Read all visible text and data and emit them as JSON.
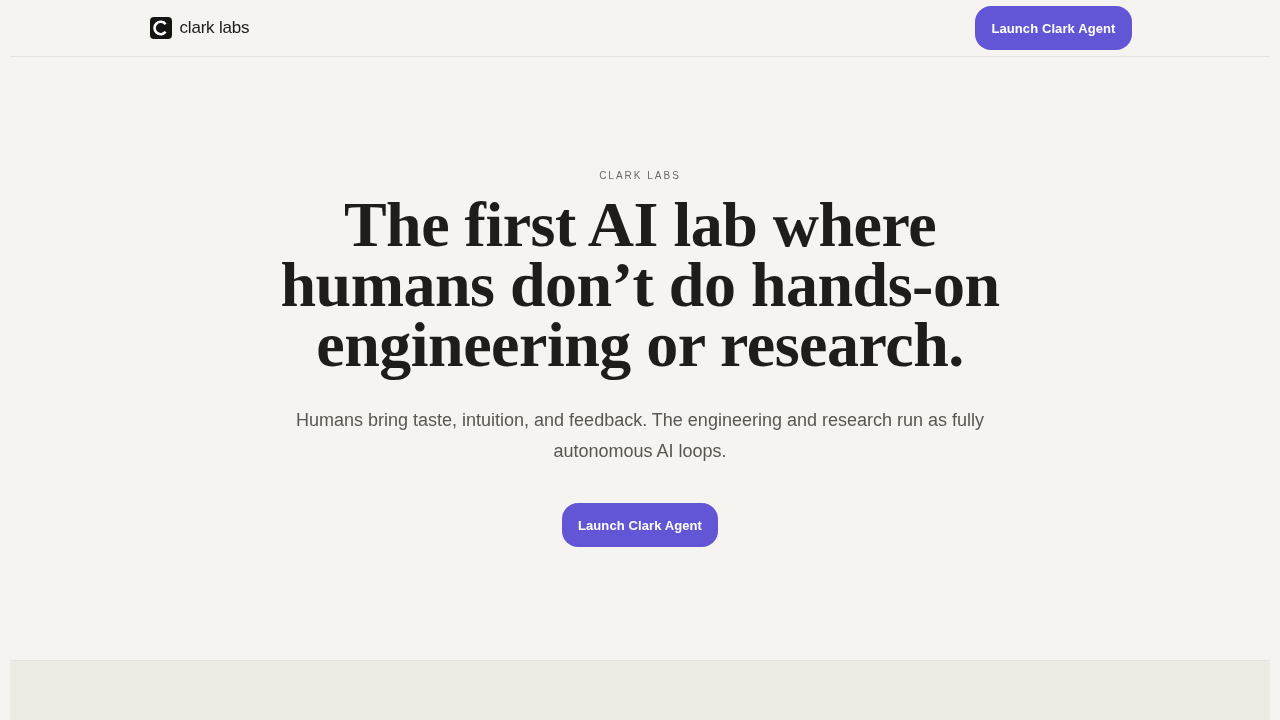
{
  "header": {
    "brand": "clark labs",
    "button": "Launch Clark Agent"
  },
  "hero": {
    "eyebrow": "CLARK LABS",
    "title": "The first AI lab where humans don’t do hands-on engineering or research.",
    "subtitle": "Humans bring taste, intuition, and feedback. The engineering and research run as fully autonomous AI loops.",
    "button": "Launch Clark Agent"
  }
}
